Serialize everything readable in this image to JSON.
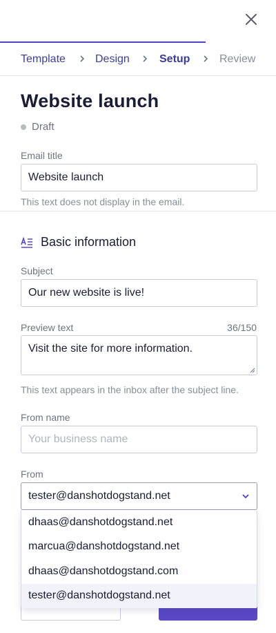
{
  "stepper": {
    "steps": [
      {
        "label": "Template",
        "state": "completed"
      },
      {
        "label": "Design",
        "state": "completed"
      },
      {
        "label": "Setup",
        "state": "active"
      },
      {
        "label": "Review",
        "state": "upcoming"
      }
    ]
  },
  "icons": {
    "close": "close-icon",
    "chevron": "chevron-right-icon",
    "section": "text-format-icon",
    "select": "chevron-down-icon"
  },
  "colors": {
    "accent": "#4c3fc9",
    "primary_button": "#5a48c6",
    "draft_dot": "#b9bbc4"
  },
  "header": {
    "title": "Website launch",
    "status": "Draft"
  },
  "email_title": {
    "label": "Email title",
    "value": "Website launch",
    "help": "This text does not display in the email."
  },
  "basic_info": {
    "title": "Basic information",
    "subject": {
      "label": "Subject",
      "value": "Our new website is live!"
    },
    "preview": {
      "label": "Preview text",
      "counter": "36/150",
      "value": "Visit the site for more information.",
      "help": "This text appears in the inbox after the subject line."
    },
    "from_name": {
      "label": "From name",
      "placeholder": "Your business name"
    },
    "from": {
      "label": "From",
      "selected": "tester@danshotdogstand.net",
      "options": [
        "dhaas@danshotdogstand.net",
        "marcua@danshotdogstand.net",
        "dhaas@danshotdogstand.com",
        "tester@danshotdogstand.net"
      ]
    }
  }
}
